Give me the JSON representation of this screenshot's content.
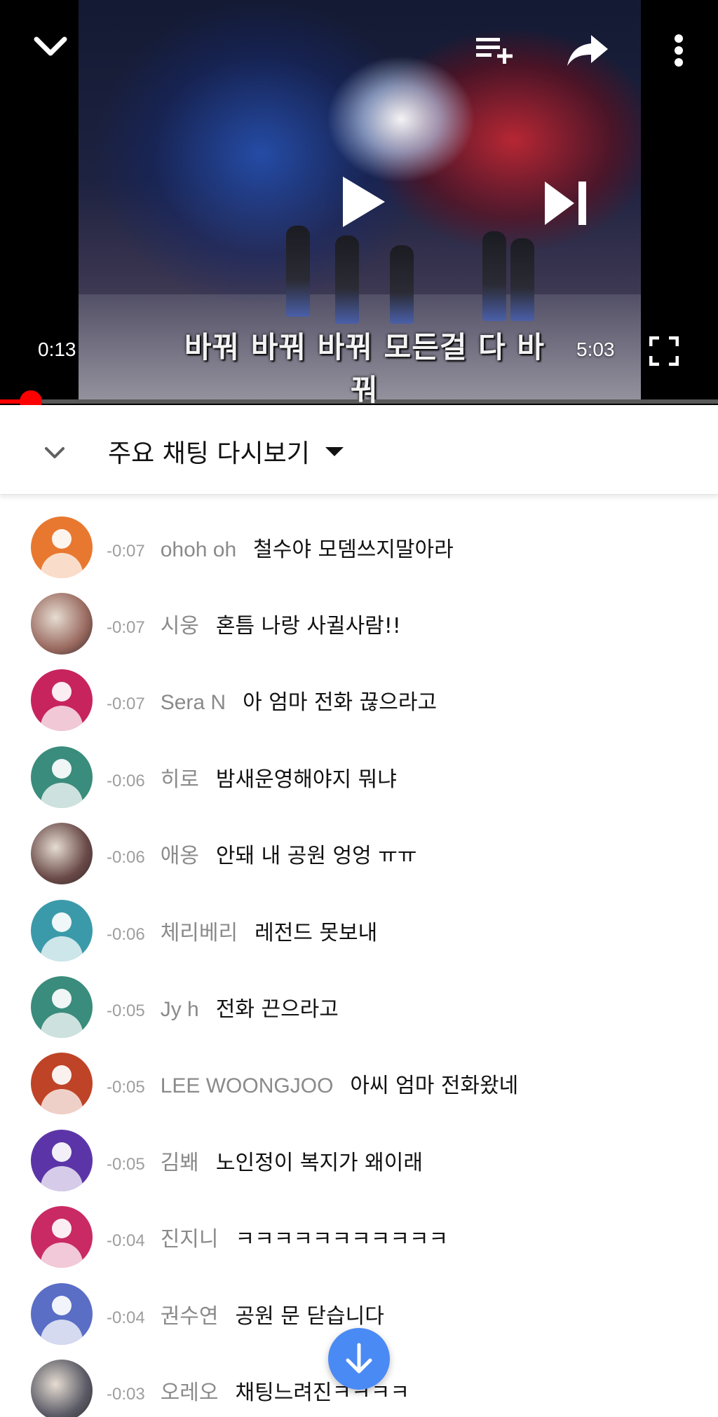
{
  "player": {
    "current_time": "0:13",
    "duration": "5:03",
    "subtitle": "바꿔 바꿔 바꿔 모든걸 다 바꿔",
    "progress": 0.043,
    "colors": {
      "progress": "#ff0000",
      "icon": "#ffffff"
    },
    "icons": {
      "minimize": "chevron-down-icon",
      "add_to_queue": "playlist-add-icon",
      "share": "share-icon",
      "more": "more-vert-icon",
      "play": "play-icon",
      "next": "skip-next-icon",
      "fullscreen": "fullscreen-icon"
    }
  },
  "chat_header": {
    "mode_label": "주요 채팅 다시보기",
    "icons": {
      "collapse": "chevron-down-icon",
      "dropdown": "caret-down-icon"
    }
  },
  "chat": {
    "messages": [
      {
        "time": "-0:07",
        "author": "ohoh oh",
        "text": "철수야 모뎀쓰지말아라",
        "avatar_color": "#e8782f",
        "avatar_type": "default"
      },
      {
        "time": "-0:07",
        "author": "시웅",
        "text": "혼틈 나랑 사귈사람!!",
        "avatar_color": "#9a6a60",
        "avatar_type": "photo"
      },
      {
        "time": "-0:07",
        "author": "Sera N",
        "text": "아 엄마 전화 끊으라고",
        "avatar_color": "#c7245e",
        "avatar_type": "default"
      },
      {
        "time": "-0:06",
        "author": "히로",
        "text": "밤새운영해야지 뭐냐",
        "avatar_color": "#3a8c7c",
        "avatar_type": "default"
      },
      {
        "time": "-0:06",
        "author": "애옹",
        "text": "안돼 내 공원 엉엉 ㅠㅠ",
        "avatar_color": "#6a4a48",
        "avatar_type": "photo"
      },
      {
        "time": "-0:06",
        "author": "체리베리",
        "text": "레전드 못보내",
        "avatar_color": "#3b9aaa",
        "avatar_type": "default"
      },
      {
        "time": "-0:05",
        "author": "Jy h",
        "text": "전화 끈으라고",
        "avatar_color": "#3a8c7c",
        "avatar_type": "default"
      },
      {
        "time": "-0:05",
        "author": "LEE WOONGJOO",
        "text": "아씨 엄마 전화왔네",
        "avatar_color": "#bf4326",
        "avatar_type": "default"
      },
      {
        "time": "-0:05",
        "author": "김봬",
        "text": "노인정이 복지가 왜이래",
        "avatar_color": "#5b35a8",
        "avatar_type": "default"
      },
      {
        "time": "-0:04",
        "author": "진지니",
        "text": "ㅋㅋㅋㅋㅋㅋㅋㅋㅋㅋㅋ",
        "avatar_color": "#c92a63",
        "avatar_type": "default"
      },
      {
        "time": "-0:04",
        "author": "권수연",
        "text": "공원 문 닫습니다",
        "avatar_color": "#5a6ec6",
        "avatar_type": "default"
      },
      {
        "time": "-0:03",
        "author": "오레오",
        "text": "채팅느려진ㅋㅋㅋㅋ",
        "avatar_color": "#5b5b66",
        "avatar_type": "photo"
      }
    ]
  },
  "scroll_to_bottom": {
    "icon": "arrow-down-icon",
    "color": "#4a8af4"
  }
}
